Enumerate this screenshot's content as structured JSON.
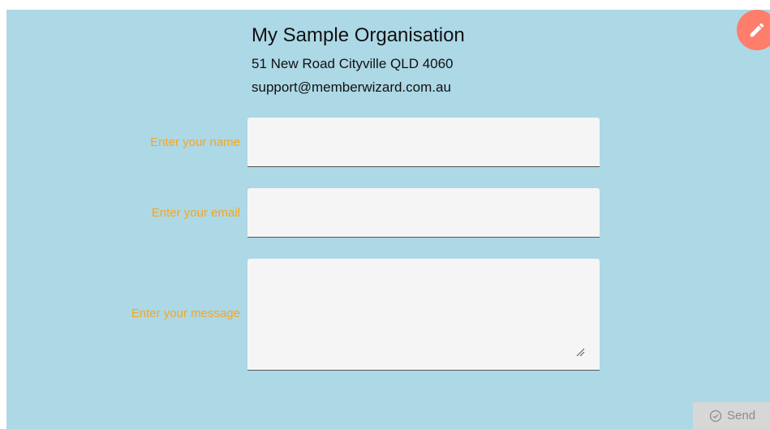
{
  "organisation": {
    "name": "My Sample Organisation",
    "address": "51 New Road Cityville QLD 4060",
    "email": "support@memberwizard.com.au"
  },
  "form": {
    "name_label": "Enter your name",
    "name_value": "",
    "email_label": "Enter your email",
    "email_value": "",
    "message_label": "Enter your message",
    "message_value": ""
  },
  "actions": {
    "send_label": "Send",
    "send_icon": "check-circle-icon",
    "edit_icon": "pencil-icon"
  },
  "colors": {
    "background": "#add8e6",
    "label": "#f5a623",
    "fab": "#ff7d6b",
    "send_disabled": "#d7d7d7"
  }
}
